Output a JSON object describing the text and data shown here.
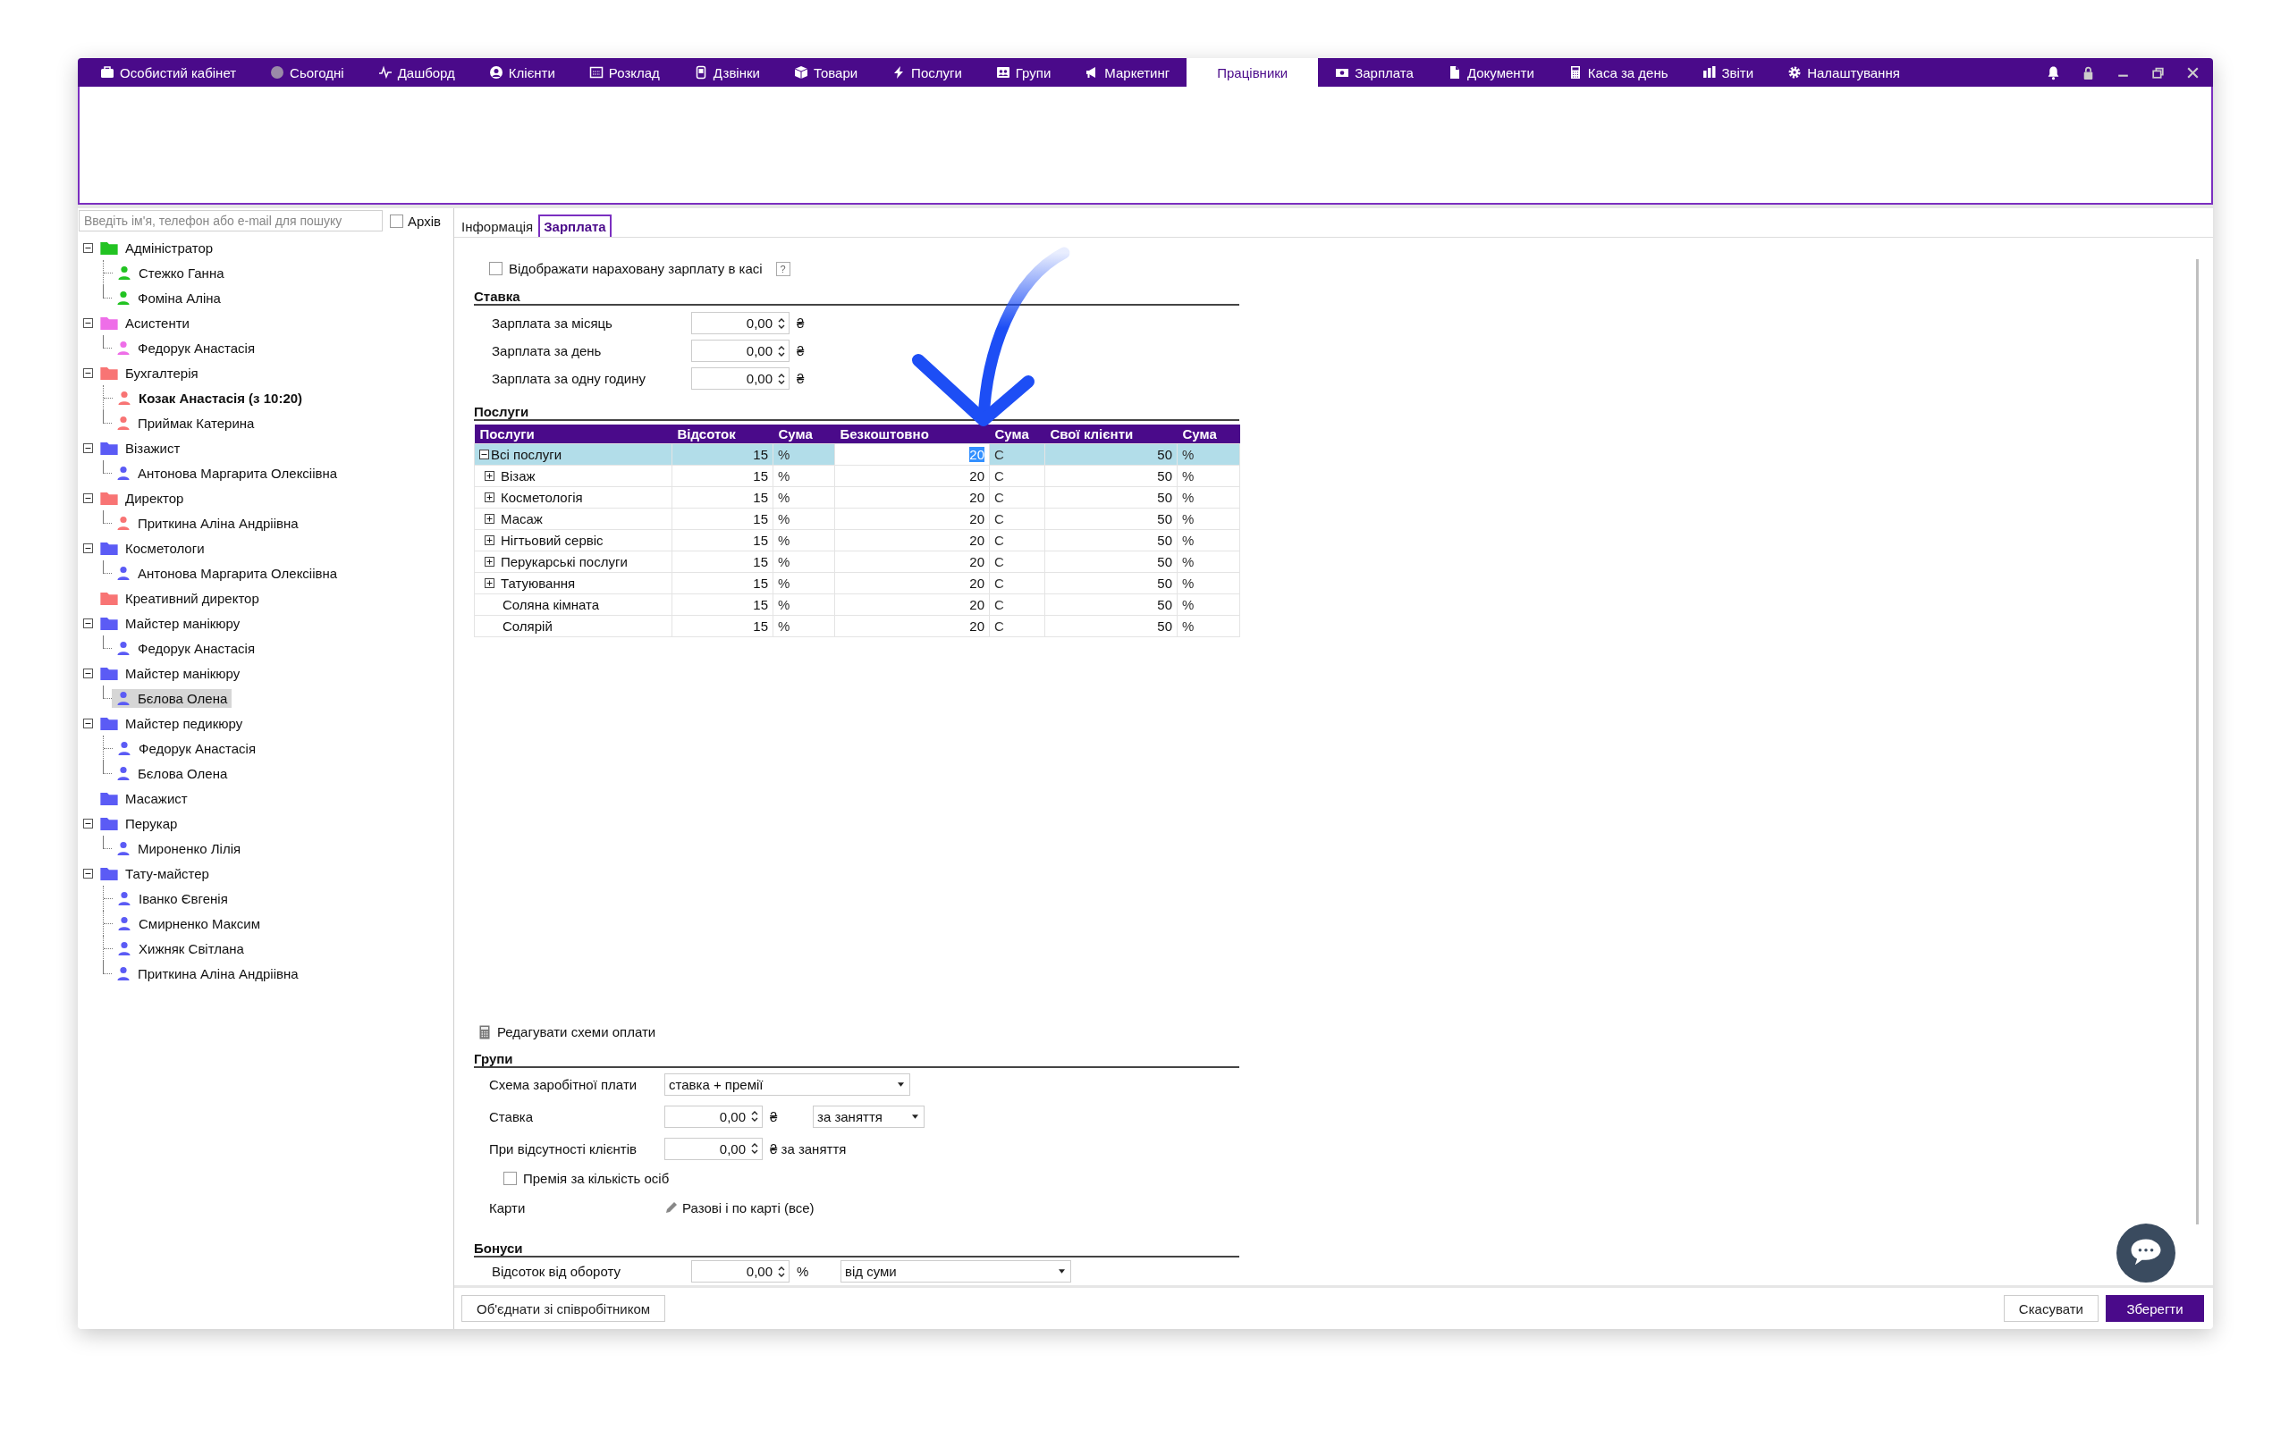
{
  "menu": [
    {
      "label": "Особистий кабінет",
      "selected": false
    },
    {
      "label": "Сьогодні",
      "selected": false
    },
    {
      "label": "Дашборд",
      "selected": false
    },
    {
      "label": "Клієнти",
      "selected": false
    },
    {
      "label": "Розклад",
      "selected": false
    },
    {
      "label": "Дзвінки",
      "selected": false
    },
    {
      "label": "Товари",
      "selected": false
    },
    {
      "label": "Послуги",
      "selected": false
    },
    {
      "label": "Групи",
      "selected": false
    },
    {
      "label": "Маркетинг",
      "selected": false
    },
    {
      "label": "Працівники",
      "selected": true
    },
    {
      "label": "Зарплата",
      "selected": false
    },
    {
      "label": "Документи",
      "selected": false
    },
    {
      "label": "Каса за день",
      "selected": false
    },
    {
      "label": "Звіти",
      "selected": false
    },
    {
      "label": "Налаштування",
      "selected": false
    }
  ],
  "search": {
    "placeholder": "Введіть ім'я, телефон або e-mail для пошуку"
  },
  "archive": {
    "label": "Архів",
    "checked": false
  },
  "tree": [
    {
      "label": "Адміністратор",
      "color": "#22c322",
      "expanded": true,
      "children": [
        {
          "label": "Стежко Ганна",
          "bold": false,
          "selected": false
        },
        {
          "label": "Фоміна Аліна",
          "bold": false,
          "selected": false
        }
      ]
    },
    {
      "label": "Асистенти",
      "color": "#ee6ee8",
      "expanded": true,
      "children": [
        {
          "label": "Федорук Анастасія",
          "bold": false,
          "selected": false
        }
      ]
    },
    {
      "label": "Бухгалтерія",
      "color": "#f87474",
      "expanded": true,
      "children": [
        {
          "label": "Козак Анастасія (з 10:20)",
          "bold": true,
          "selected": false
        },
        {
          "label": "Приймак Катерина",
          "bold": false,
          "selected": false
        }
      ]
    },
    {
      "label": "Візажист",
      "color": "#5b5bf5",
      "expanded": true,
      "children": [
        {
          "label": "Антонова Маргарита Олексіівна",
          "bold": false,
          "selected": false
        }
      ]
    },
    {
      "label": "Директор",
      "color": "#f87474",
      "expanded": true,
      "children": [
        {
          "label": "Приткина Аліна Андріівна",
          "bold": false,
          "selected": false
        }
      ]
    },
    {
      "label": "Косметологи",
      "color": "#5b5bf5",
      "expanded": true,
      "children": [
        {
          "label": "Антонова Маргарита Олексіівна",
          "bold": false,
          "selected": false
        }
      ]
    },
    {
      "label": "Креативний директор",
      "color": "#f87474"
    },
    {
      "label": "Майстер манікюру",
      "color": "#5b5bf5",
      "expanded": true,
      "children": [
        {
          "label": "Федорук Анастасія",
          "bold": false,
          "selected": false
        }
      ]
    },
    {
      "label": "Майстер манікюру",
      "color": "#5b5bf5",
      "expanded": true,
      "children": [
        {
          "label": "Бєлова Олена",
          "bold": false,
          "selected": true
        }
      ]
    },
    {
      "label": "Майстер педикюру",
      "color": "#5b5bf5",
      "expanded": true,
      "children": [
        {
          "label": "Федорук Анастасія",
          "bold": false,
          "selected": false
        },
        {
          "label": "Бєлова Олена",
          "bold": false,
          "selected": false
        }
      ]
    },
    {
      "label": "Масажист",
      "color": "#5b5bf5"
    },
    {
      "label": "Перукар",
      "color": "#5b5bf5",
      "expanded": true,
      "children": [
        {
          "label": "Мироненко Лілія",
          "bold": false,
          "selected": false
        }
      ]
    },
    {
      "label": "Тату-майстер",
      "color": "#5b5bf5",
      "expanded": true,
      "children": [
        {
          "label": "Іванко Євгенія",
          "bold": false,
          "selected": false
        },
        {
          "label": "Смирненко Максим",
          "bold": false,
          "selected": false
        },
        {
          "label": "Хижняк Світлана",
          "bold": false,
          "selected": false
        },
        {
          "label": "Приткина Аліна Андріівна",
          "bold": false,
          "selected": false
        }
      ]
    }
  ],
  "tabs": [
    {
      "label": "Інформація",
      "selected": false
    },
    {
      "label": "Зарплата",
      "selected": true
    }
  ],
  "show_in_cash": {
    "label": "Відображати нараховану зарплату в касі",
    "checked": false,
    "help": "?"
  },
  "rate": {
    "title": "Ставка",
    "fields": [
      {
        "label": "Зарплата за місяць",
        "value": "0,00",
        "unit": "₴"
      },
      {
        "label": "Зарплата за день",
        "value": "0,00",
        "unit": "₴"
      },
      {
        "label": "Зарплата за одну годину",
        "value": "0,00",
        "unit": "₴"
      }
    ]
  },
  "services": {
    "title": "Послуги",
    "columns": [
      "Послуги",
      "Відсоток",
      "Сума",
      "Безкоштовно",
      "Сума",
      "Свої клієнти",
      "Сума"
    ],
    "rows": [
      {
        "name": "Всі послуги",
        "expanded": true,
        "selected": true,
        "percent": "15",
        "percent_unit": "%",
        "free": "20",
        "free_unit": "С",
        "own": "50",
        "own_unit": "%"
      },
      {
        "name": "Візаж",
        "expanded": false,
        "selected": false,
        "percent": "15",
        "percent_unit": "%",
        "free": "20",
        "free_unit": "С",
        "own": "50",
        "own_unit": "%"
      },
      {
        "name": "Косметологія",
        "expanded": false,
        "selected": false,
        "percent": "15",
        "percent_unit": "%",
        "free": "20",
        "free_unit": "С",
        "own": "50",
        "own_unit": "%"
      },
      {
        "name": "Масаж",
        "expanded": false,
        "selected": false,
        "percent": "15",
        "percent_unit": "%",
        "free": "20",
        "free_unit": "С",
        "own": "50",
        "own_unit": "%"
      },
      {
        "name": "Нігтьовий сервіс",
        "expanded": false,
        "selected": false,
        "percent": "15",
        "percent_unit": "%",
        "free": "20",
        "free_unit": "С",
        "own": "50",
        "own_unit": "%"
      },
      {
        "name": "Перукарські послуги",
        "expanded": false,
        "selected": false,
        "percent": "15",
        "percent_unit": "%",
        "free": "20",
        "free_unit": "С",
        "own": "50",
        "own_unit": "%"
      },
      {
        "name": "Татуювання",
        "expanded": false,
        "selected": false,
        "percent": "15",
        "percent_unit": "%",
        "free": "20",
        "free_unit": "С",
        "own": "50",
        "own_unit": "%"
      },
      {
        "name": "Соляна кімната",
        "selected": false,
        "percent": "15",
        "percent_unit": "%",
        "free": "20",
        "free_unit": "С",
        "own": "50",
        "own_unit": "%"
      },
      {
        "name": "Солярій",
        "selected": false,
        "percent": "15",
        "percent_unit": "%",
        "free": "20",
        "free_unit": "С",
        "own": "50",
        "own_unit": "%"
      }
    ]
  },
  "edit_schemes": {
    "label": "Редагувати схеми оплати"
  },
  "groups": {
    "title": "Групи",
    "scheme": {
      "label": "Схема заробітної плати",
      "value": "ставка + премії"
    },
    "rate": {
      "label": "Ставка",
      "value": "0,00",
      "unit": "₴",
      "period": "за заняття"
    },
    "no_clients": {
      "label": "При відсутності клієнтів",
      "value": "0,00",
      "unit": "₴ за заняття"
    },
    "bonus_per_person": {
      "label": "Премія за кількість осіб",
      "checked": false
    },
    "cards": {
      "label": "Карти",
      "value": "Разові і по карті (все)"
    }
  },
  "bonuses": {
    "title": "Бонуси",
    "turnover": {
      "label": "Відсоток від обороту",
      "value": "0,00",
      "unit": "%",
      "basis": "від суми"
    }
  },
  "footer": {
    "merge": "Об'єднати зі співробітником",
    "cancel": "Скасувати",
    "save": "Зберегти"
  }
}
